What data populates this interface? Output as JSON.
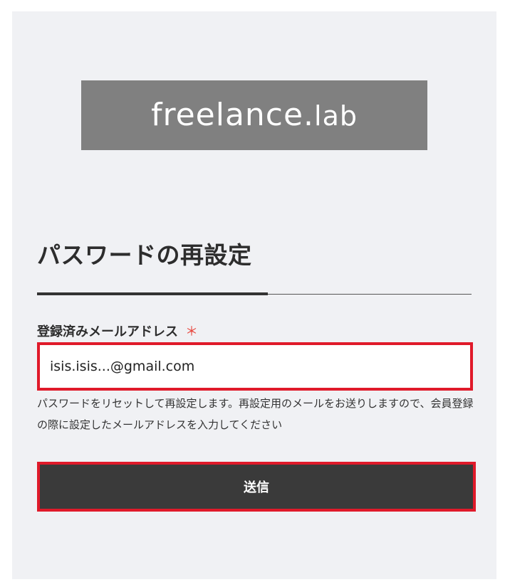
{
  "logo": {
    "name": "freelance.",
    "suffix": "lab"
  },
  "page": {
    "title": "パスワードの再設定"
  },
  "form": {
    "email_label": "登録済みメールアドレス",
    "required_mark": "＊",
    "email_value": "isis.isis...@gmail.com",
    "help_text": "パスワードをリセットして再設定します。再設定用のメールをお送りしますので、会員登録の際に設定したメールアドレスを入力してください",
    "submit_label": "送信"
  },
  "colors": {
    "card_background": "#f0f1f4",
    "logo_background": "#808080",
    "button_background": "#3a3a3a",
    "highlight_border": "#e01a2a",
    "required_mark": "#e8453c"
  }
}
